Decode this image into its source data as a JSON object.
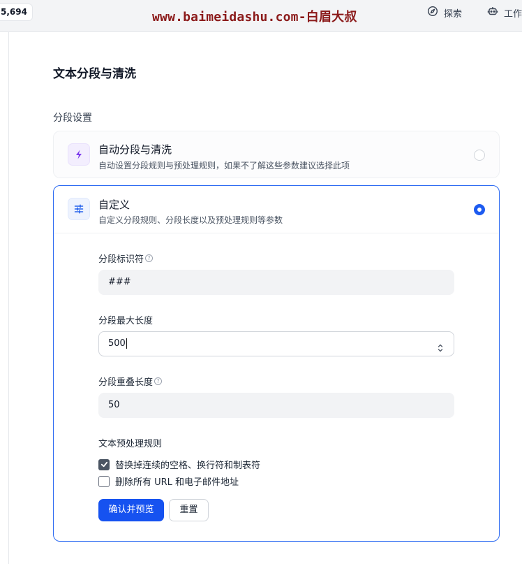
{
  "topbar": {
    "counter": "5,694",
    "watermark": "www.baimeidashu.com-白眉大叔",
    "explore_label": "探索",
    "work_label": "工作"
  },
  "page": {
    "title": "文本分段与清洗",
    "section_label": "分段设置"
  },
  "options": {
    "auto": {
      "title": "自动分段与清洗",
      "description": "自动设置分段规则与预处理规则，如果不了解这些参数建议选择此项",
      "selected": false
    },
    "custom": {
      "title": "自定义",
      "description": "自定义分段规则、分段长度以及预处理规则等参数",
      "selected": true
    }
  },
  "form": {
    "separator": {
      "label": "分段标识符",
      "value": "###"
    },
    "max_length": {
      "label": "分段最大长度",
      "value": "500"
    },
    "overlap": {
      "label": "分段重叠长度",
      "value": "50"
    },
    "preprocess": {
      "label": "文本预处理规则",
      "rules": [
        {
          "label": "替换掉连续的空格、换行符和制表符",
          "checked": true
        },
        {
          "label": "删除所有 URL 和电子邮件地址",
          "checked": false
        }
      ]
    },
    "confirm_label": "确认并预览",
    "reset_label": "重置"
  },
  "colors": {
    "accent": "#1652f0",
    "watermark": "#8b1a1a",
    "auto_icon": "#7c3aed",
    "custom_icon": "#2563eb"
  },
  "icons": {
    "explore": "compass-icon",
    "work": "robot-icon",
    "auto": "lightning-icon",
    "custom": "sliders-icon"
  }
}
